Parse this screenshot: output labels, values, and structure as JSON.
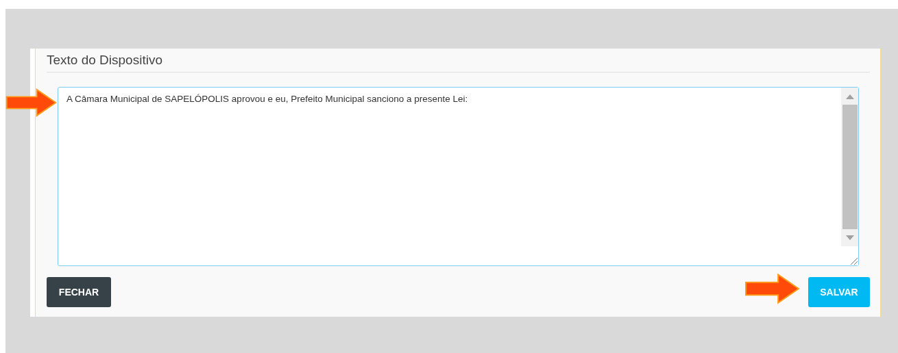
{
  "section": {
    "title": "Texto do Dispositivo"
  },
  "text_field": {
    "value": "A Câmara Municipal de SAPELÓPOLIS aprovou e eu, Prefeito Municipal sanciono a presente Lei:"
  },
  "buttons": [
    {
      "label": "FECHAR",
      "kind": "close"
    },
    {
      "label": "SALVAR",
      "kind": "save"
    }
  ]
}
